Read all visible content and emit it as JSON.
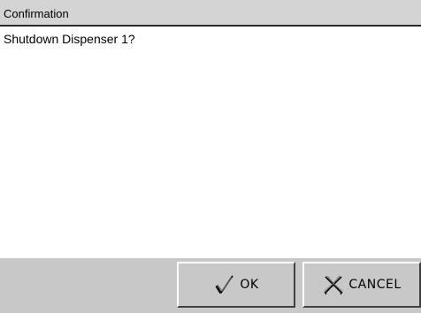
{
  "dialog": {
    "title": "Confirmation",
    "message": "Shutdown Dispenser 1?"
  },
  "buttons": {
    "ok": {
      "label": "OK",
      "icon": "checkmark-icon"
    },
    "cancel": {
      "label": "CANCEL",
      "icon": "x-cross-icon"
    }
  },
  "colors": {
    "title_bar": "#d4d4d4",
    "button_bar": "#c8c8c8",
    "background": "#ffffff"
  }
}
